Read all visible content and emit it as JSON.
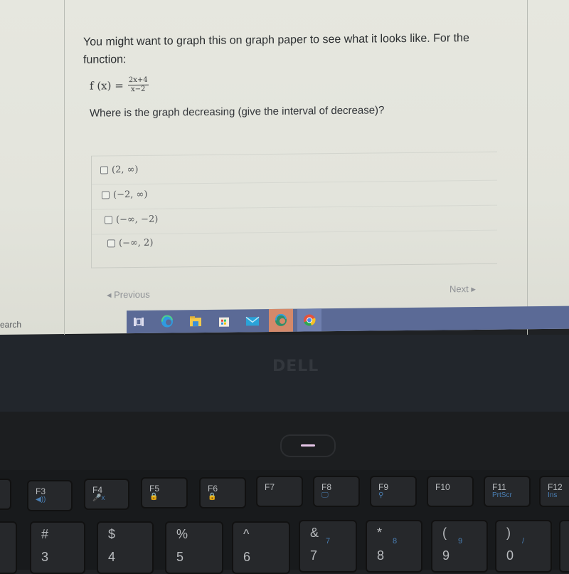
{
  "question": {
    "intro": "You might want to graph this on graph paper to see what it looks like. For the function:",
    "function_lhs": "f (x) =",
    "numerator": "2x+4",
    "denominator": "x−2",
    "prompt": "Where is the graph decreasing (give the interval of decrease)?"
  },
  "options": [
    {
      "label": "(2, ∞)",
      "checked": false
    },
    {
      "label": "(−2, ∞)",
      "checked": false
    },
    {
      "label": "(−∞, −2)",
      "checked": false
    },
    {
      "label": "(−∞, 2)",
      "checked": false
    }
  ],
  "navigation": {
    "previous": "◂ Previous",
    "next": "Next ▸"
  },
  "taskbar": {
    "search_text": "earch",
    "icons": [
      "task-view-icon",
      "edge-icon",
      "file-explorer-icon",
      "store-icon",
      "mail-icon",
      "edge-dev-icon",
      "chrome-icon"
    ]
  },
  "laptop": {
    "brand": "DELL"
  },
  "keyboard": {
    "function_keys": [
      {
        "label": "F3",
        "sub": "◀))"
      },
      {
        "label": "F4",
        "sub": "🎤x"
      },
      {
        "label": "F5",
        "sub": "🔒"
      },
      {
        "label": "F6",
        "sub": "🔒"
      },
      {
        "label": "F7",
        "sub": ""
      },
      {
        "label": "F8",
        "sub": "🖵"
      },
      {
        "label": "F9",
        "sub": "⚲"
      },
      {
        "label": "F10",
        "sub": ""
      },
      {
        "label": "F11",
        "sub": "PrtScr"
      },
      {
        "label": "F12",
        "sub": "Ins"
      }
    ],
    "number_keys": [
      {
        "top": "#",
        "bottom": "3",
        "alt": ""
      },
      {
        "top": "$",
        "bottom": "4",
        "alt": ""
      },
      {
        "top": "%",
        "bottom": "5",
        "alt": ""
      },
      {
        "top": "^",
        "bottom": "6",
        "alt": ""
      },
      {
        "top": "&",
        "bottom": "7",
        "alt": "7"
      },
      {
        "top": "*",
        "bottom": "8",
        "alt": "8"
      },
      {
        "top": "(",
        "bottom": "9",
        "alt": "9"
      },
      {
        "top": ")",
        "bottom": "0",
        "alt": "/"
      }
    ]
  }
}
